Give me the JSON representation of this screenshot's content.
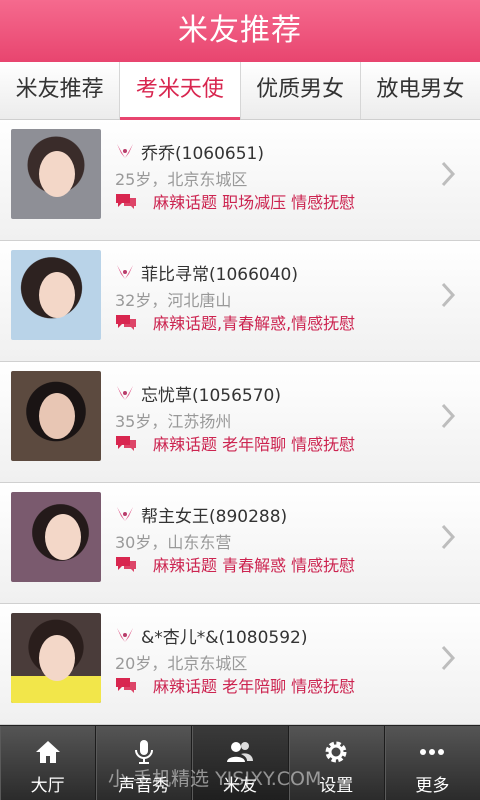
{
  "app": {
    "title": "米友推荐"
  },
  "tabs": [
    {
      "label": "米友推荐",
      "active": false
    },
    {
      "label": "考米天使",
      "active": true
    },
    {
      "label": "优质男女",
      "active": false
    },
    {
      "label": "放电男女",
      "active": false
    }
  ],
  "list": [
    {
      "name": "乔乔(1060651)",
      "meta": "25岁，北京东城区",
      "tags": "麻辣话题 职场减压 情感抚慰"
    },
    {
      "name": "菲比寻常(1066040)",
      "meta": "32岁，河北唐山",
      "tags": "麻辣话题,青春解惑,情感抚慰"
    },
    {
      "name": "忘忧草(1056570)",
      "meta": "35岁，江苏扬州",
      "tags": "麻辣话题 老年陪聊 情感抚慰"
    },
    {
      "name": "帮主女王(890288)",
      "meta": "30岁，山东东营",
      "tags": "麻辣话题 青春解惑 情感抚慰"
    },
    {
      "name": "&*杏儿*&(1080592)",
      "meta": "20岁，北京东城区",
      "tags": "麻辣话题 老年陪聊 情感抚慰"
    }
  ],
  "bottom_nav": [
    {
      "label": "大厅",
      "icon": "home-icon"
    },
    {
      "label": "声音秀",
      "icon": "microphone-icon"
    },
    {
      "label": "米友",
      "icon": "people-icon"
    },
    {
      "label": "设置",
      "icon": "gear-icon"
    },
    {
      "label": "更多",
      "icon": "more-dots-icon"
    }
  ],
  "watermark": "小 手机精选 YJSJXY.COM",
  "colors": {
    "accent": "#e8456f",
    "tag_text": "#cc2450",
    "meta_text": "#999999"
  }
}
